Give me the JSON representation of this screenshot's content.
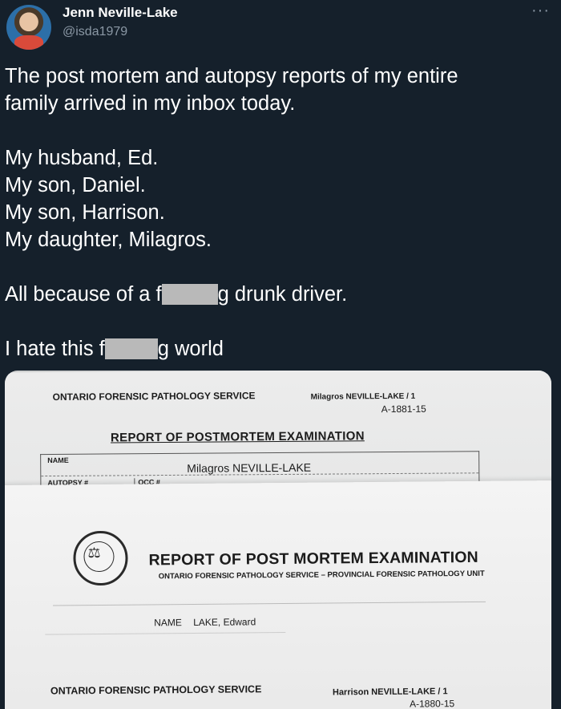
{
  "author": {
    "display_name": "Jenn Neville-Lake",
    "handle": "@isda1979",
    "avatar_icon": "avatar-photo"
  },
  "menu": {
    "more_label": "···"
  },
  "tweet": {
    "line1": "The post mortem and autopsy reports of my entire",
    "line2": "family arrived in my inbox today.",
    "line3": "My husband, Ed.",
    "line4": "My son, Daniel.",
    "line5": "My son, Harrison.",
    "line6": "My daughter, Milagros.",
    "line7_a": "All because of a f",
    "line7_b": "g drunk driver.",
    "line8_a": "I hate this f",
    "line8_b": "g world",
    "redaction_color": "#b9b9b9"
  },
  "photo": {
    "sheet1": {
      "service": "ONTARIO FORENSIC PATHOLOGY SERVICE",
      "patient": "Milagros NEVILLE-LAKE  / 1",
      "case_no": "A-1881-15",
      "title": "REPORT OF POSTMORTEM EXAMINATION",
      "name_label": "NAME",
      "name_value": "Milagros NEVILLE-LAKE",
      "autopsy_label": "AUTOPSY #",
      "occ_label": "OCC #"
    },
    "sheet2": {
      "seal_icon": "scales-of-justice-seal",
      "title": "REPORT OF POST MORTEM EXAMINATION",
      "subtitle": "ONTARIO FORENSIC PATHOLOGY SERVICE – PROVINCIAL FORENSIC PATHOLOGY UNIT",
      "name_label": "NAME",
      "name_value": "LAKE, Edward",
      "service": "ONTARIO FORENSIC PATHOLOGY SERVICE",
      "patient": "Harrison NEVILLE-LAKE  / 1",
      "case_no": "A-1880-15"
    }
  },
  "colors": {
    "background": "#15202b",
    "text": "#ffffff",
    "secondary_text": "#8b98a5"
  }
}
